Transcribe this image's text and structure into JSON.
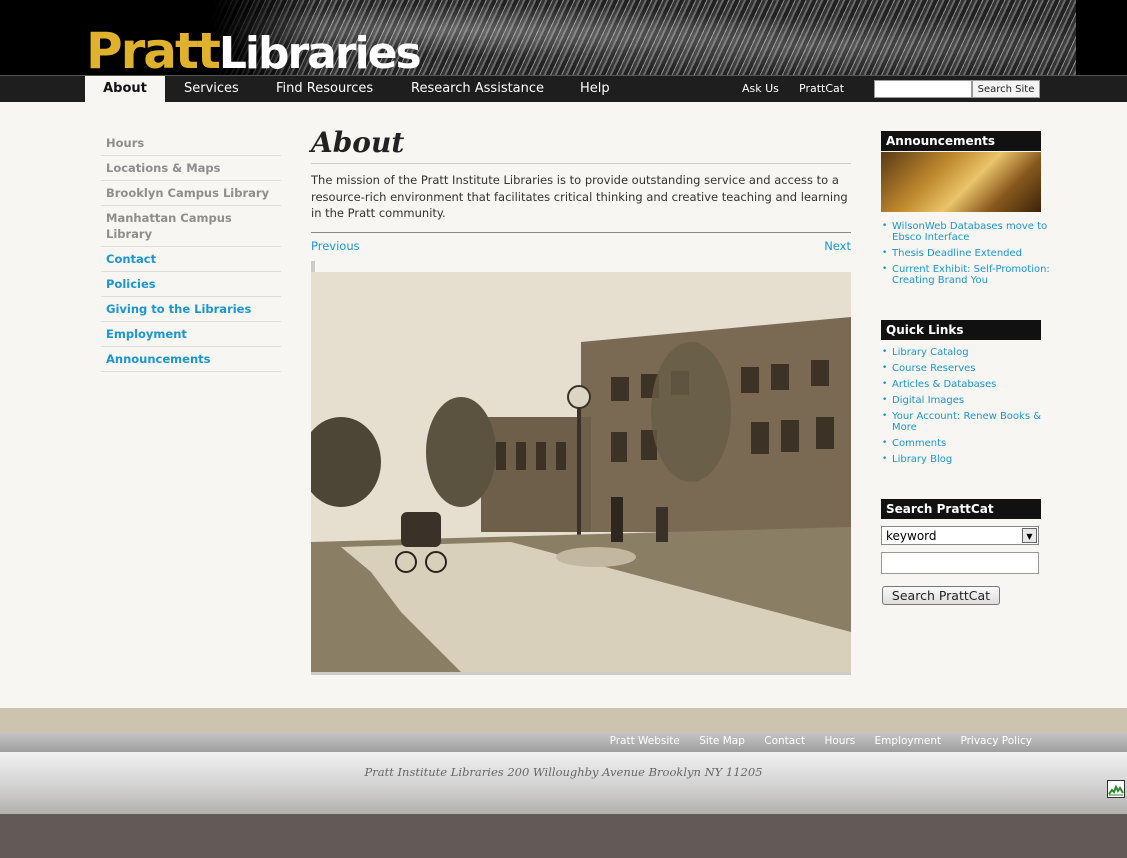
{
  "logo": {
    "part1": "Pratt",
    "part2": "Libraries"
  },
  "nav": {
    "tabs": [
      {
        "label": "About",
        "active": true
      },
      {
        "label": "Services"
      },
      {
        "label": "Find Resources"
      },
      {
        "label": "Research Assistance"
      },
      {
        "label": "Help"
      }
    ],
    "ask_us": "Ask Us",
    "prattcat": "PrattCat",
    "search_button": "Search Site",
    "search_value": ""
  },
  "sidebar": {
    "items": [
      {
        "label": "Hours"
      },
      {
        "label": "Locations & Maps"
      },
      {
        "label": "Brooklyn Campus Library"
      },
      {
        "label": "Manhattan Campus Library"
      },
      {
        "label": "Contact"
      },
      {
        "label": "Policies"
      },
      {
        "label": "Giving to the Libraries"
      },
      {
        "label": "Employment"
      },
      {
        "label": "Announcements"
      }
    ]
  },
  "main": {
    "title": "About",
    "mission": "The mission of the Pratt Institute Libraries is to provide outstanding service and access to a resource-rich environment that facilitates critical thinking and creative teaching and learning in the Pratt community.",
    "previous": "Previous",
    "next": "Next"
  },
  "announcements": {
    "heading": "Announcements",
    "items": [
      "WilsonWeb Databases move to Ebsco Interface",
      "Thesis Deadline Extended",
      "Current Exhibit: Self-Promotion: Creating Brand You"
    ]
  },
  "quick_links": {
    "heading": "Quick Links",
    "items": [
      "Library Catalog",
      "Course Reserves",
      "Articles & Databases",
      "Digital Images",
      "Your Account: Renew Books & More",
      "Comments",
      "Library Blog"
    ]
  },
  "search_prattcat": {
    "heading": "Search PrattCat",
    "select_value": "keyword",
    "input_value": "",
    "button": "Search PrattCat"
  },
  "footer": {
    "links": [
      "Pratt Website",
      "Site Map",
      "Contact",
      "Hours",
      "Employment",
      "Privacy Policy"
    ],
    "address": "Pratt Institute Libraries 200 Willoughby Avenue Brooklyn NY 11205"
  },
  "colors": {
    "accent_gold": "#e0b12c",
    "link_blue": "#1a96d3",
    "nav_dark": "#1e1e1e"
  }
}
